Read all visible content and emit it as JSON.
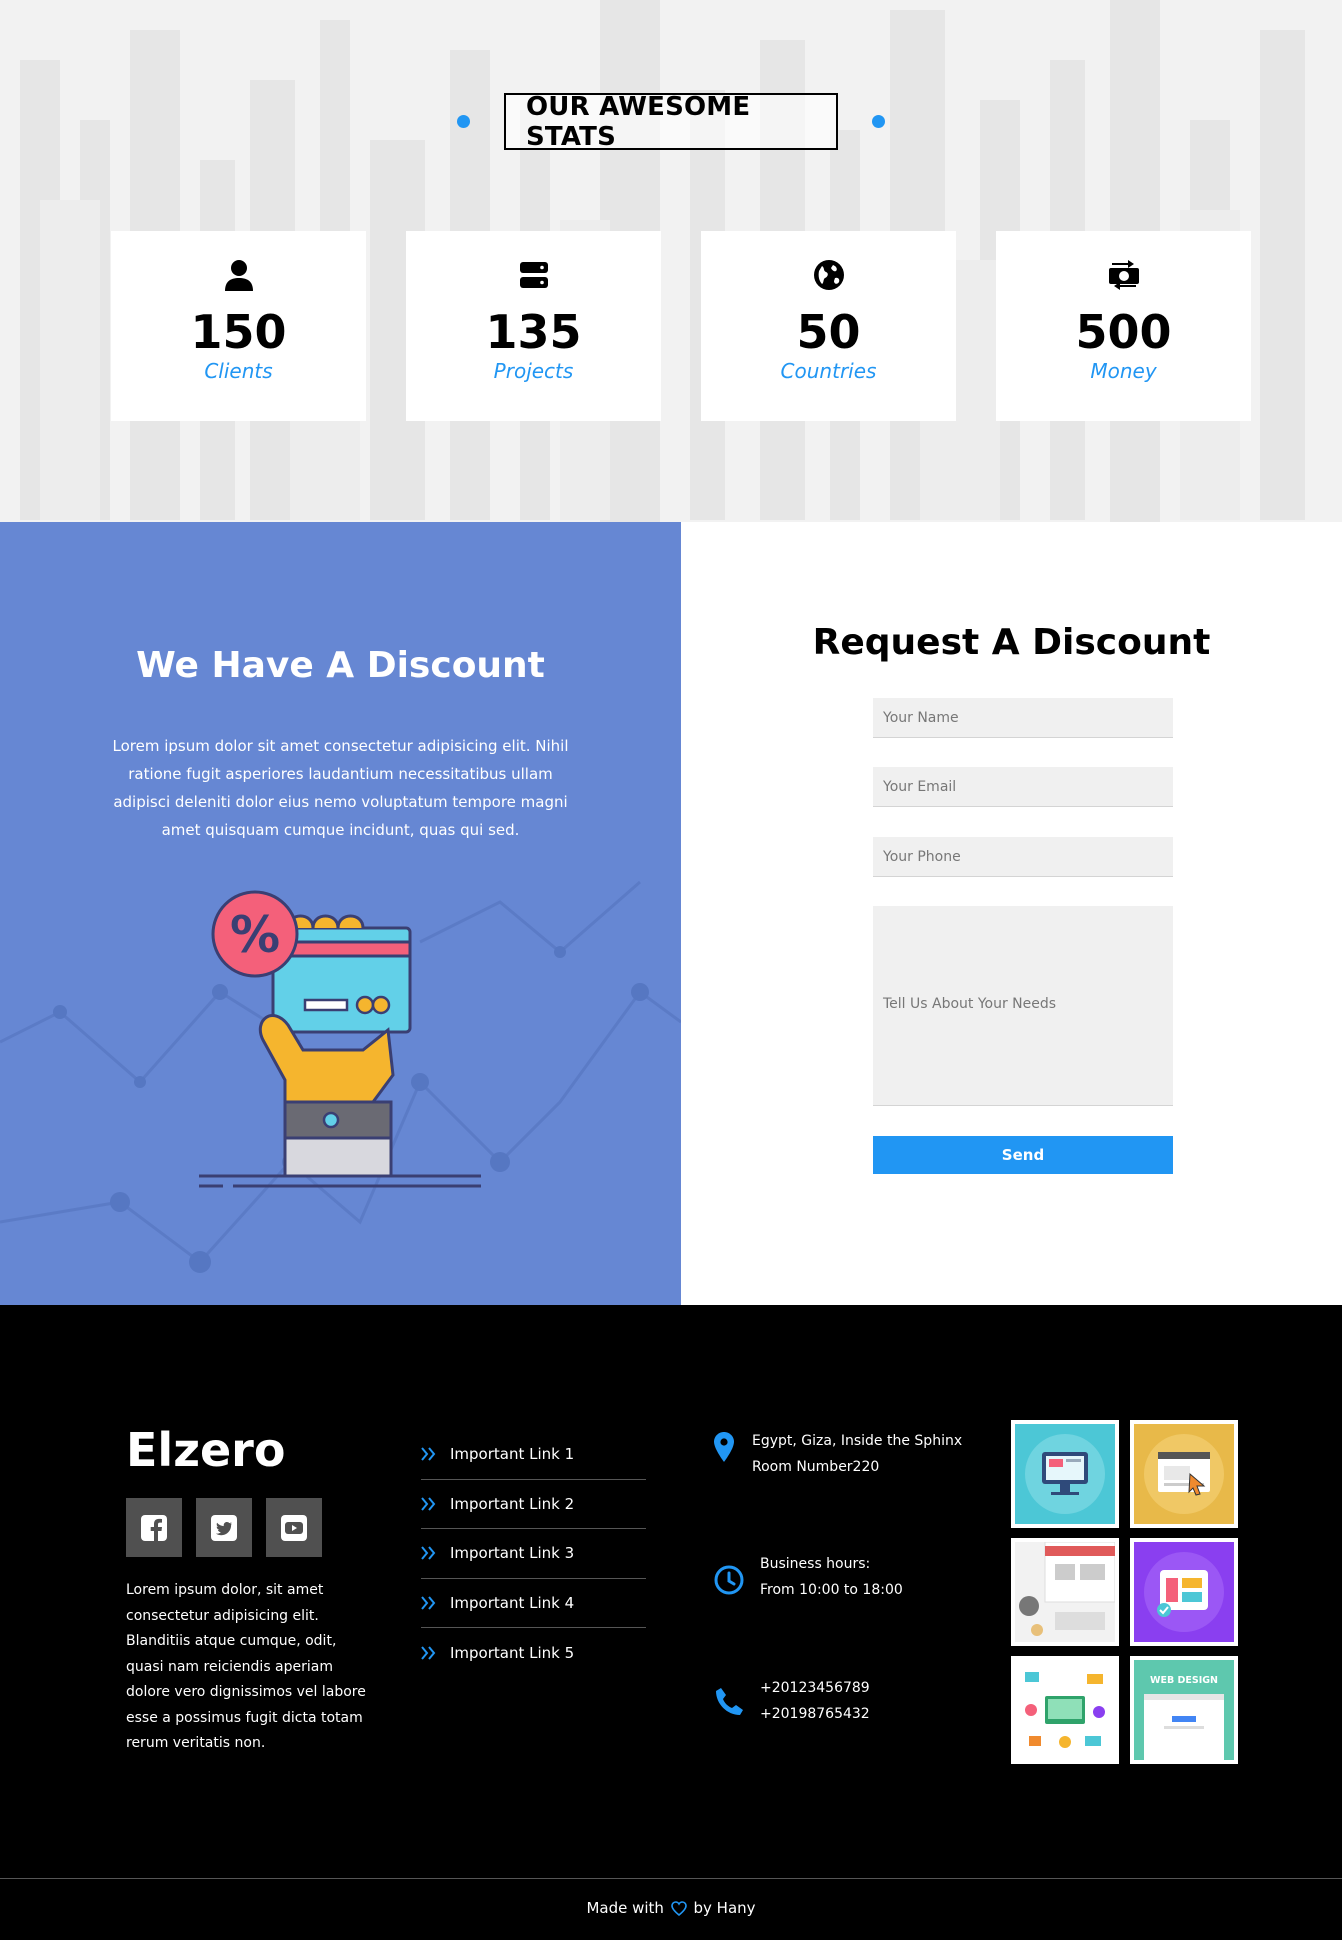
{
  "stats": {
    "title": "OUR AWESOME STATS",
    "items": [
      {
        "icon": "user-icon",
        "number": "150",
        "label": "Clients"
      },
      {
        "icon": "server-icon",
        "number": "135",
        "label": "Projects"
      },
      {
        "icon": "globe-icon",
        "number": "50",
        "label": "Countries"
      },
      {
        "icon": "money-exchange-icon",
        "number": "500",
        "label": "Money"
      }
    ]
  },
  "discount": {
    "left_title": "We Have A Discount",
    "left_text": "Lorem ipsum dolor sit amet consectetur adipisicing elit. Nihil ratione fugit asperiores laudantium necessitatibus ullam adipisci deleniti dolor eius nemo voluptatum tempore magni amet quisquam cumque incidunt, quas qui sed.",
    "form_title": "Request A Discount",
    "name_placeholder": "Your Name",
    "email_placeholder": "Your Email",
    "phone_placeholder": "Your Phone",
    "message_placeholder": "Tell Us About Your Needs",
    "send_label": "Send",
    "illustration_badge": "%"
  },
  "footer": {
    "brand": "Elzero",
    "social": [
      "facebook-icon",
      "twitter-icon",
      "youtube-icon"
    ],
    "about": "Lorem ipsum dolor, sit amet consectetur adipisicing elit. Blanditiis atque cumque, odit, quasi nam reiciendis aperiam dolore vero dignissimos vel labore esse a possimus fugit dicta totam rerum veritatis non.",
    "links": [
      "Important Link 1",
      "Important Link 2",
      "Important Link 3",
      "Important Link 4",
      "Important Link 5"
    ],
    "address_line1": "Egypt, Giza, Inside the Sphinx",
    "address_line2": "Room Number220",
    "hours_line1": "Business hours:",
    "hours_line2": "From 10:00 to 18:00",
    "phone1": "+20123456789",
    "phone2": "+20198765432",
    "gallery_badge": "WEB DESIGN",
    "copyright_prefix": "Made with",
    "copyright_suffix": "by Hany",
    "accent": "#2196f3"
  }
}
